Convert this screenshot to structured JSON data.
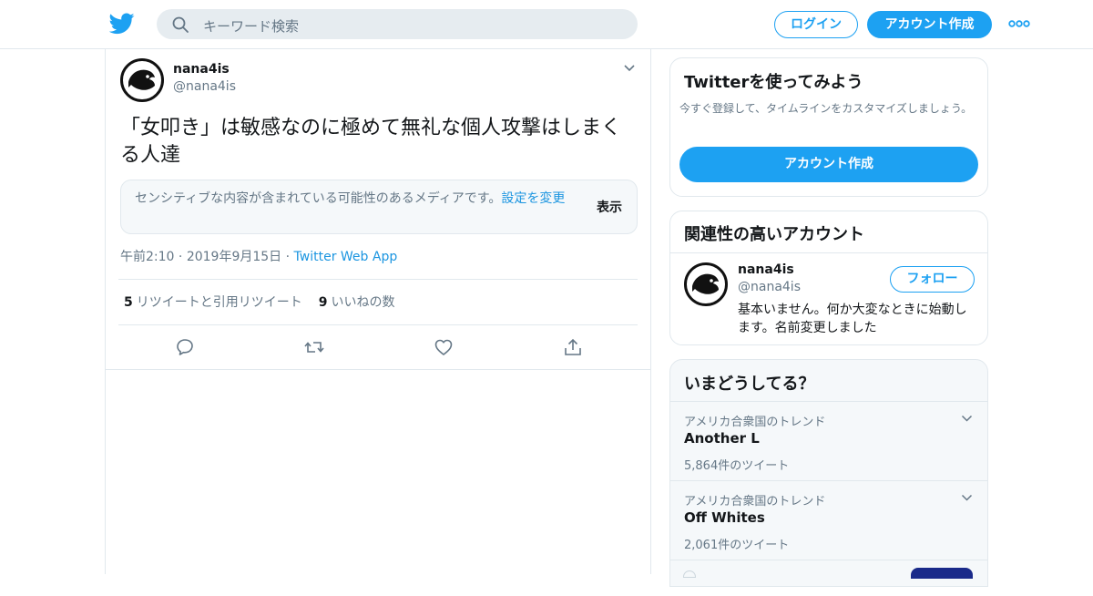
{
  "header": {
    "search_placeholder": "キーワード検索",
    "login_label": "ログイン",
    "signup_label": "アカウント作成"
  },
  "tweet": {
    "display_name": "nana4is",
    "handle": "@nana4is",
    "text": "「女叩き」は敏感なのに極めて無礼な個人攻撃はしまくる人達",
    "sensitive_message": "センシティブな内容が含まれている可能性のあるメディアです。",
    "sensitive_link": "設定を変更",
    "show_label": "表示",
    "time": "午前2:10",
    "date": "2019年9月15日",
    "app": "Twitter Web App",
    "retweet_count": "5",
    "retweet_label": "リツイートと引用リツイート",
    "like_count": "9",
    "like_label": "いいねの数"
  },
  "sidebar": {
    "signup_card": {
      "title": "Twitterを使ってみよう",
      "description": "今すぐ登録して、タイムラインをカスタマイズしましょう。",
      "button_label": "アカウント作成"
    },
    "related": {
      "title": "関連性の高いアカウント",
      "account": {
        "display_name": "nana4is",
        "handle": "@nana4is",
        "follow_label": "フォロー",
        "bio": "基本いません。何か大変なときに始動します。名前変更しました"
      }
    },
    "trends": {
      "title": "いまどうしてる？",
      "items": [
        {
          "location": "アメリカ合衆国のトレンド",
          "name": "Another L",
          "count": "5,864件のツイート"
        },
        {
          "location": "アメリカ合衆国のトレンド",
          "name": "Off Whites",
          "count": "2,061件のツイート"
        }
      ]
    }
  },
  "colors": {
    "accent": "#1da1f2",
    "link": "#1b95e0",
    "text_secondary": "#657786",
    "border": "#e1e8ed"
  }
}
